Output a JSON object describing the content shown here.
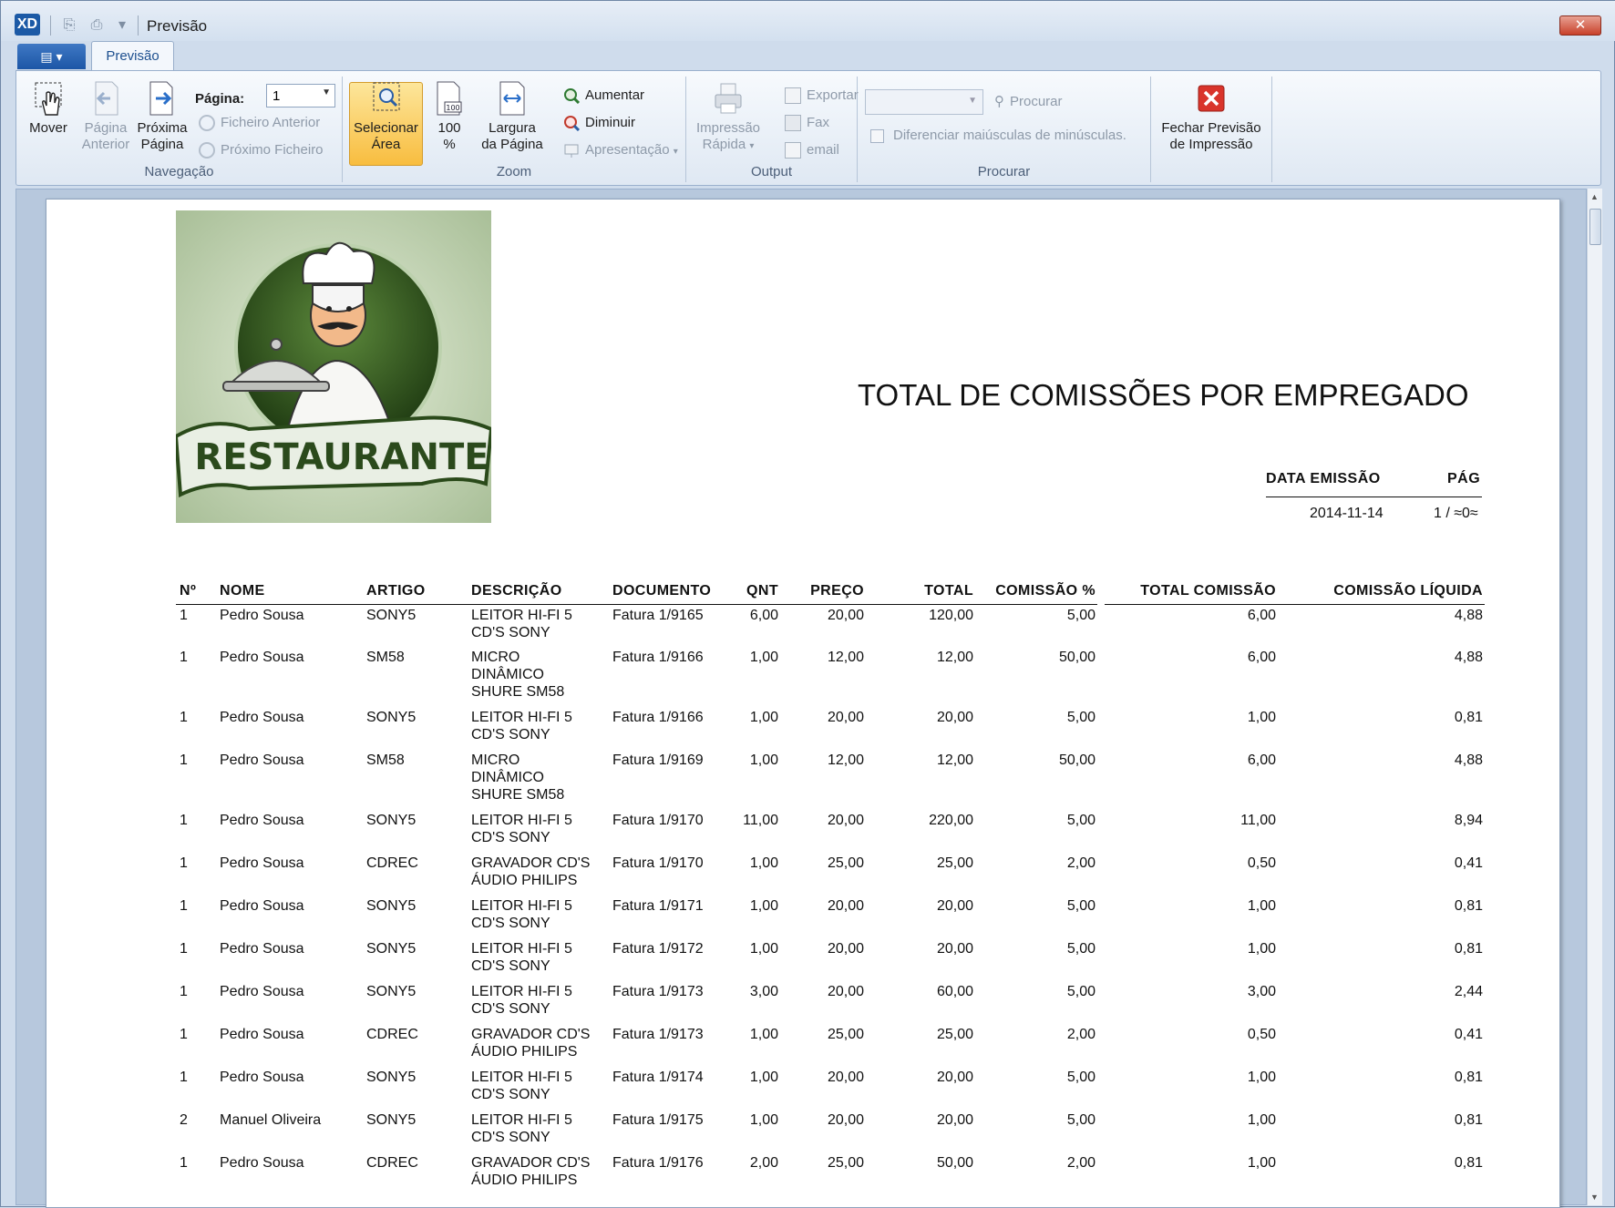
{
  "window": {
    "title": "Previsão",
    "app_icon": "XD"
  },
  "tabs": {
    "file": "▤ ▾",
    "active": "Previsão"
  },
  "ribbon": {
    "navegacao": {
      "label": "Navegação",
      "mover": "Mover",
      "pagina_anterior": [
        "Página",
        "Anterior"
      ],
      "proxima_pagina": [
        "Próxima",
        "Página"
      ],
      "pagina_label": "Página:",
      "pagina_value": "1",
      "ficheiro_anterior": "Ficheiro Anterior",
      "proximo_ficheiro": "Próximo Ficheiro"
    },
    "zoom": {
      "label": "Zoom",
      "selecionar_area": [
        "Selecionar",
        "Área"
      ],
      "cem": [
        "100",
        "%"
      ],
      "largura": [
        "Largura",
        "da Página"
      ],
      "aumentar": "Aumentar",
      "diminuir": "Diminuir",
      "apresentacao": "Apresentação"
    },
    "output": {
      "label": "Output",
      "impressao": [
        "Impressão",
        "Rápida"
      ],
      "exportar": "Exportar",
      "fax": "Fax",
      "email": "email"
    },
    "procurar": {
      "label": "Procurar",
      "procurar": "Procurar",
      "diferenciar": "Diferenciar maiúsculas de minúsculas."
    },
    "fechar": [
      "Fechar Previsão",
      "de Impressão"
    ]
  },
  "report": {
    "logo_text": "RESTAURANTE",
    "title": "TOTAL DE COMISSÕES POR EMPREGADO",
    "data_emissao_label": "DATA EMISSÃO",
    "pag_label": "PÁG",
    "data_emissao": "2014-11-14",
    "pag": "1 / ≈0≈",
    "columns": [
      "Nº",
      "NOME",
      "ARTIGO",
      "DESCRIÇÃO",
      "DOCUMENTO",
      "QNT",
      "PREÇO",
      "TOTAL",
      "COMISSÃO %",
      "TOTAL COMISSÃO",
      "COMISSÃO LÍQUIDA"
    ],
    "rows": [
      {
        "n": "1",
        "nome": "Pedro Sousa",
        "artigo": "SONY5",
        "desc": [
          "LEITOR HI-FI 5",
          "CD'S SONY"
        ],
        "doc": "Fatura 1/9165",
        "qnt": "6,00",
        "preco": "20,00",
        "total": "120,00",
        "com": "5,00",
        "tcom": "6,00",
        "liq": "4,88"
      },
      {
        "n": "1",
        "nome": "Pedro Sousa",
        "artigo": "SM58",
        "desc": [
          "MICRO",
          "DINÂMICO",
          "SHURE SM58"
        ],
        "doc": "Fatura 1/9166",
        "qnt": "1,00",
        "preco": "12,00",
        "total": "12,00",
        "com": "50,00",
        "tcom": "6,00",
        "liq": "4,88"
      },
      {
        "n": "1",
        "nome": "Pedro Sousa",
        "artigo": "SONY5",
        "desc": [
          "LEITOR HI-FI 5",
          "CD'S SONY"
        ],
        "doc": "Fatura 1/9166",
        "qnt": "1,00",
        "preco": "20,00",
        "total": "20,00",
        "com": "5,00",
        "tcom": "1,00",
        "liq": "0,81"
      },
      {
        "n": "1",
        "nome": "Pedro Sousa",
        "artigo": "SM58",
        "desc": [
          "MICRO",
          "DINÂMICO",
          "SHURE SM58"
        ],
        "doc": "Fatura 1/9169",
        "qnt": "1,00",
        "preco": "12,00",
        "total": "12,00",
        "com": "50,00",
        "tcom": "6,00",
        "liq": "4,88"
      },
      {
        "n": "1",
        "nome": "Pedro Sousa",
        "artigo": "SONY5",
        "desc": [
          "LEITOR HI-FI 5",
          "CD'S SONY"
        ],
        "doc": "Fatura 1/9170",
        "qnt": "11,00",
        "preco": "20,00",
        "total": "220,00",
        "com": "5,00",
        "tcom": "11,00",
        "liq": "8,94"
      },
      {
        "n": "1",
        "nome": "Pedro Sousa",
        "artigo": "CDREC",
        "desc": [
          "GRAVADOR CD'S",
          "ÁUDIO PHILIPS"
        ],
        "doc": "Fatura 1/9170",
        "qnt": "1,00",
        "preco": "25,00",
        "total": "25,00",
        "com": "2,00",
        "tcom": "0,50",
        "liq": "0,41"
      },
      {
        "n": "1",
        "nome": "Pedro Sousa",
        "artigo": "SONY5",
        "desc": [
          "LEITOR HI-FI 5",
          "CD'S SONY"
        ],
        "doc": "Fatura 1/9171",
        "qnt": "1,00",
        "preco": "20,00",
        "total": "20,00",
        "com": "5,00",
        "tcom": "1,00",
        "liq": "0,81"
      },
      {
        "n": "1",
        "nome": "Pedro Sousa",
        "artigo": "SONY5",
        "desc": [
          "LEITOR HI-FI 5",
          "CD'S SONY"
        ],
        "doc": "Fatura 1/9172",
        "qnt": "1,00",
        "preco": "20,00",
        "total": "20,00",
        "com": "5,00",
        "tcom": "1,00",
        "liq": "0,81"
      },
      {
        "n": "1",
        "nome": "Pedro Sousa",
        "artigo": "SONY5",
        "desc": [
          "LEITOR HI-FI 5",
          "CD'S SONY"
        ],
        "doc": "Fatura 1/9173",
        "qnt": "3,00",
        "preco": "20,00",
        "total": "60,00",
        "com": "5,00",
        "tcom": "3,00",
        "liq": "2,44"
      },
      {
        "n": "1",
        "nome": "Pedro Sousa",
        "artigo": "CDREC",
        "desc": [
          "GRAVADOR CD'S",
          "ÁUDIO PHILIPS"
        ],
        "doc": "Fatura 1/9173",
        "qnt": "1,00",
        "preco": "25,00",
        "total": "25,00",
        "com": "2,00",
        "tcom": "0,50",
        "liq": "0,41"
      },
      {
        "n": "1",
        "nome": "Pedro Sousa",
        "artigo": "SONY5",
        "desc": [
          "LEITOR HI-FI 5",
          "CD'S SONY"
        ],
        "doc": "Fatura 1/9174",
        "qnt": "1,00",
        "preco": "20,00",
        "total": "20,00",
        "com": "5,00",
        "tcom": "1,00",
        "liq": "0,81"
      },
      {
        "n": "2",
        "nome": "Manuel Oliveira",
        "artigo": "SONY5",
        "desc": [
          "LEITOR HI-FI 5",
          "CD'S SONY"
        ],
        "doc": "Fatura 1/9175",
        "qnt": "1,00",
        "preco": "20,00",
        "total": "20,00",
        "com": "5,00",
        "tcom": "1,00",
        "liq": "0,81"
      },
      {
        "n": "1",
        "nome": "Pedro Sousa",
        "artigo": "CDREC",
        "desc": [
          "GRAVADOR CD'S",
          "ÁUDIO PHILIPS"
        ],
        "doc": "Fatura 1/9176",
        "qnt": "2,00",
        "preco": "25,00",
        "total": "50,00",
        "com": "2,00",
        "tcom": "1,00",
        "liq": "0,81"
      }
    ]
  }
}
